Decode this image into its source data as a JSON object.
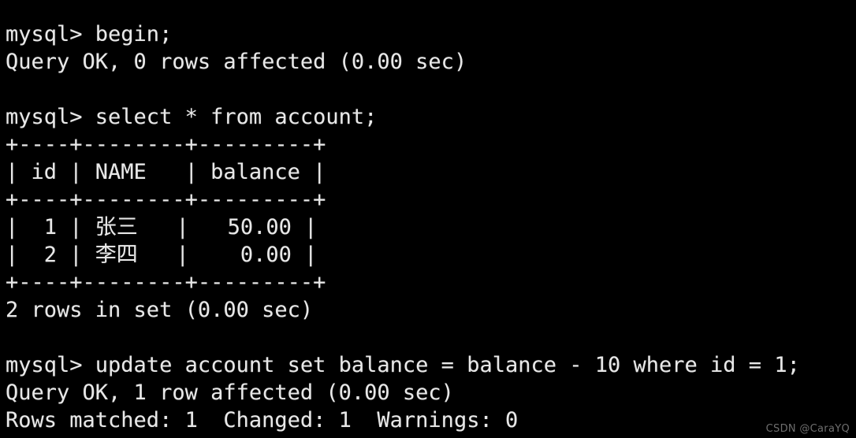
{
  "terminal": {
    "background_color": "#000000",
    "text_color": "#e8e8e8",
    "prompt": "mysql>",
    "lines": [
      {
        "id": "line-1",
        "text": "mysql> begin;"
      },
      {
        "id": "line-2",
        "text": "Query OK, 0 rows affected (0.00 sec)"
      },
      {
        "id": "line-3",
        "text": ""
      },
      {
        "id": "line-4",
        "text": "mysql> select * from account;"
      },
      {
        "id": "line-5",
        "text": "+----+--------+---------+"
      },
      {
        "id": "line-6",
        "text": "| id | NAME   | balance |"
      },
      {
        "id": "line-7",
        "text": "+----+--------+---------+"
      },
      {
        "id": "line-8",
        "text": "|  1 | 张三   |   50.00 |"
      },
      {
        "id": "line-9",
        "text": "|  2 | 李四   |    0.00 |"
      },
      {
        "id": "line-10",
        "text": "+----+--------+---------+"
      },
      {
        "id": "line-11",
        "text": "2 rows in set (0.00 sec)"
      },
      {
        "id": "line-12",
        "text": ""
      },
      {
        "id": "line-13",
        "text": "mysql> update account set balance = balance - 10 where id = 1;"
      },
      {
        "id": "line-14",
        "text": "Query OK, 1 row affected (0.00 sec)"
      },
      {
        "id": "line-15",
        "text": "Rows matched: 1  Changed: 1  Warnings: 0"
      }
    ],
    "commands": [
      "begin;",
      "select * from account;",
      "update account set balance = balance - 10 where id = 1;"
    ],
    "results": {
      "begin_result": "Query OK, 0 rows affected (0.00 sec)",
      "select_row_count": "2 rows in set (0.00 sec)",
      "update_result": "Query OK, 1 row affected (0.00 sec)",
      "update_detail": "Rows matched: 1  Changed: 1  Warnings: 0"
    },
    "table": {
      "name": "account",
      "border": "+----+--------+---------+",
      "columns": [
        "id",
        "NAME",
        "balance"
      ],
      "rows": [
        {
          "id": "1",
          "name": "张三",
          "balance": "50.00"
        },
        {
          "id": "2",
          "name": "李四",
          "balance": "0.00"
        }
      ]
    }
  },
  "watermark": {
    "text": "CSDN @CaraYQ",
    "color": "#6e6e6e"
  }
}
